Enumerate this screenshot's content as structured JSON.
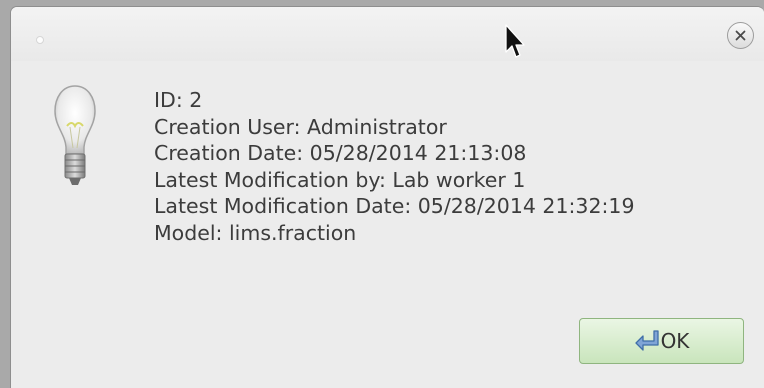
{
  "dialog": {
    "info_lines": [
      "ID: 2",
      "Creation User: Administrator",
      "Creation Date: 05/28/2014 21:13:08",
      "Latest Modification by: Lab worker 1",
      "Latest Modification Date: 05/28/2014 21:32:19",
      "Model: lims.fraction"
    ],
    "ok_label": "OK",
    "icons": {
      "window": "window-dot-icon",
      "close": "close-icon",
      "info": "lightbulb-icon",
      "ok": "ok-arrow-icon",
      "cursor": "mouse-pointer-icon"
    },
    "colors": {
      "ok_button": "#c9e5bc",
      "text": "#3c3c3c",
      "background": "#ececec"
    }
  }
}
